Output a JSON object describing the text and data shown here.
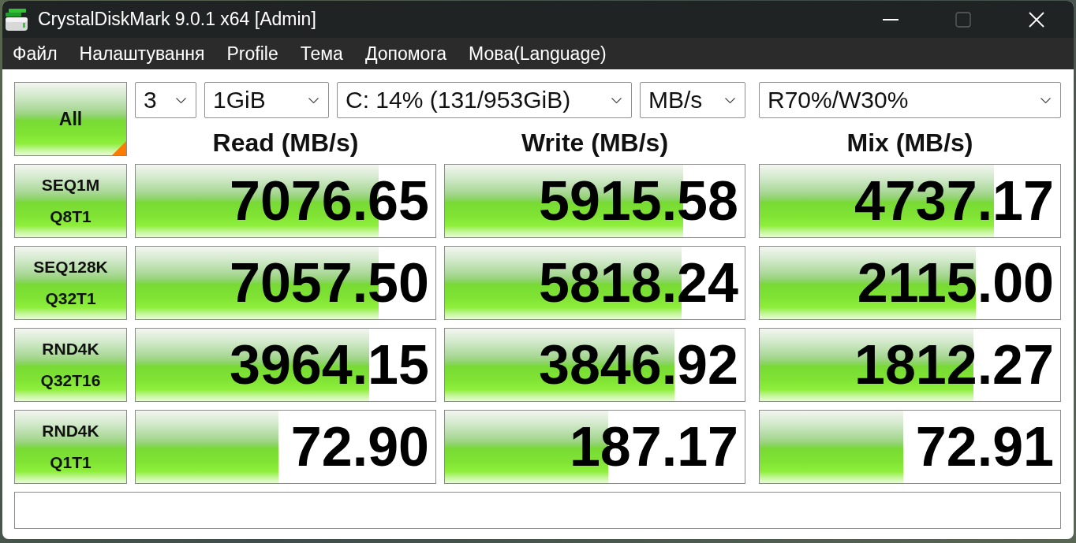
{
  "window": {
    "title": "CrystalDiskMark 9.0.1 x64 [Admin]",
    "controls": [
      {
        "kind": "minimize",
        "disabled": false
      },
      {
        "kind": "maximize",
        "disabled": true
      },
      {
        "kind": "close",
        "disabled": false
      }
    ]
  },
  "menu": [
    "Файл",
    "Налаштування",
    "Profile",
    "Тема",
    "Допомога",
    "Мова(Language)"
  ],
  "toolbar": {
    "all_button": "All",
    "selectors": [
      {
        "value": "3"
      },
      {
        "value": "1GiB"
      },
      {
        "value": "C: 14% (131/953GiB)"
      },
      {
        "value": "MB/s"
      },
      {
        "value": "R70%/W30%"
      }
    ]
  },
  "columns": [
    "Read (MB/s)",
    "Write (MB/s)",
    "Mix (MB/s)"
  ],
  "rows": [
    {
      "label": "SEQ1M\nQ8T1",
      "results": [
        {
          "value": "7076.65",
          "level": 0.81
        },
        {
          "value": "5915.58",
          "level": 0.795
        },
        {
          "value": "4737.17",
          "level": 0.78
        }
      ]
    },
    {
      "label": "SEQ128K\nQ32T1",
      "results": [
        {
          "value": "7057.50",
          "level": 0.81
        },
        {
          "value": "5818.24",
          "level": 0.79
        },
        {
          "value": "2115.00",
          "level": 0.72
        }
      ]
    },
    {
      "label": "RND4K\nQ32T16",
      "results": [
        {
          "value": "3964.15",
          "level": 0.78
        },
        {
          "value": "3846.92",
          "level": 0.765
        },
        {
          "value": "1812.27",
          "level": 0.71
        }
      ]
    },
    {
      "label": "RND4K\nQ1T1",
      "results": [
        {
          "value": "72.90",
          "level": 0.477
        },
        {
          "value": "187.17",
          "level": 0.545
        },
        {
          "value": "72.91",
          "level": 0.478
        }
      ]
    }
  ]
}
